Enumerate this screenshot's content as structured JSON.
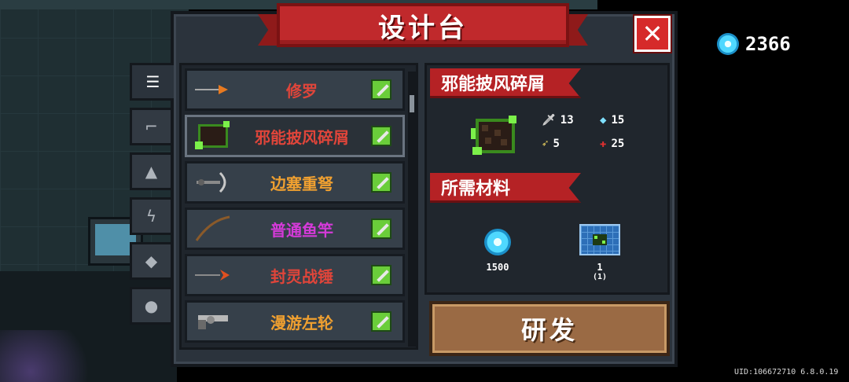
{
  "title": "设计台",
  "close_label": "✕",
  "currency": {
    "icon": "gem-icon",
    "value": "2366"
  },
  "tabs": [
    {
      "icon": "list-icon",
      "glyph": "☰",
      "active": true
    },
    {
      "icon": "gun-icon",
      "glyph": "⌐",
      "active": false
    },
    {
      "icon": "armor-icon",
      "glyph": "▲",
      "active": false
    },
    {
      "icon": "lightning-icon",
      "glyph": "ϟ",
      "active": false
    },
    {
      "icon": "pet-icon",
      "glyph": "◆",
      "active": false
    },
    {
      "icon": "statue-icon",
      "glyph": "●",
      "active": false
    }
  ],
  "weapons": [
    {
      "name": "修罗",
      "color": "#e0453a",
      "icon": "spear-icon"
    },
    {
      "name": "邪能披风碎屑",
      "color": "#e0453a",
      "icon": "fel-cloak-shard-icon",
      "selected": true
    },
    {
      "name": "边塞重弩",
      "color": "#f0a030",
      "icon": "crossbow-icon"
    },
    {
      "name": "普通鱼竿",
      "color": "#d43ad8",
      "icon": "fishing-rod-icon"
    },
    {
      "name": "封灵战锤",
      "color": "#e0453a",
      "icon": "war-hammer-icon"
    },
    {
      "name": "漫游左轮",
      "color": "#f0a030",
      "icon": "revolver-icon"
    }
  ],
  "detail": {
    "name": "邪能披风碎屑",
    "stats": [
      {
        "icon": "dagger-icon",
        "glyph": "🗡",
        "value": "13",
        "color": "#cfcfcf"
      },
      {
        "icon": "energy-crystal-icon",
        "glyph": "◆",
        "value": "15",
        "color": "#7fe0ff"
      },
      {
        "icon": "bullet-icon",
        "glyph": "➶",
        "value": "5",
        "color": "#e8d060"
      },
      {
        "icon": "crit-cross-icon",
        "glyph": "✚",
        "value": "25",
        "color": "#e03030"
      }
    ],
    "materials_title": "所需材料",
    "materials": [
      {
        "icon": "gem-icon",
        "amount": "1500",
        "sub": ""
      },
      {
        "icon": "blueprint-icon",
        "amount": "1",
        "sub": "(1)"
      }
    ]
  },
  "research_label": "研发",
  "uid": "UID:106672710 6.8.0.19"
}
